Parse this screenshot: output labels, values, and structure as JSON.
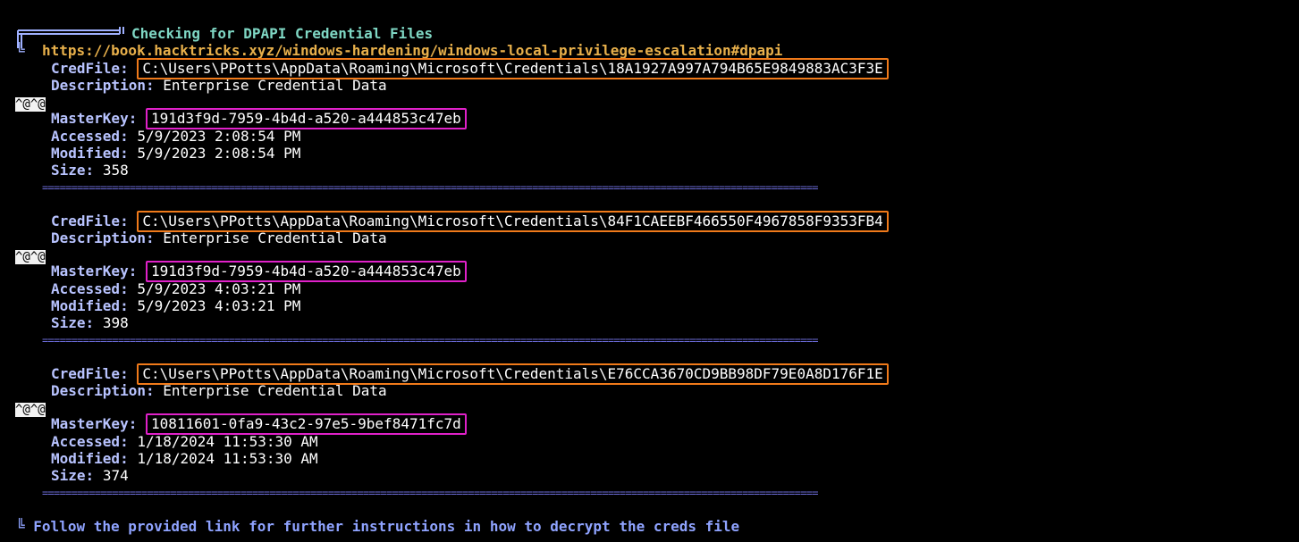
{
  "header": {
    "title": "Checking for DPAPI Credential Files",
    "link": "https://book.hacktricks.xyz/windows-hardening/windows-local-privilege-escalation#dpapi"
  },
  "labels": {
    "credfile": "CredFile:",
    "description": "Description:",
    "masterkey": "MasterKey:",
    "accessed": "Accessed:",
    "modified": "Modified:",
    "size": "Size:"
  },
  "control_marker": "^@^@",
  "separator": "=====================================================================================================================================",
  "entries": [
    {
      "credfile": "C:\\Users\\PPotts\\AppData\\Roaming\\Microsoft\\Credentials\\18A1927A997A794B65E9849883AC3F3E",
      "description": "Enterprise Credential Data",
      "masterkey": "191d3f9d-7959-4b4d-a520-a444853c47eb",
      "accessed": "5/9/2023 2:08:54 PM",
      "modified": "5/9/2023 2:08:54 PM",
      "size": "358"
    },
    {
      "credfile": "C:\\Users\\PPotts\\AppData\\Roaming\\Microsoft\\Credentials\\84F1CAEEBF466550F4967858F9353FB4",
      "description": "Enterprise Credential Data",
      "masterkey": "191d3f9d-7959-4b4d-a520-a444853c47eb",
      "accessed": "5/9/2023 4:03:21 PM",
      "modified": "5/9/2023 4:03:21 PM",
      "size": "398"
    },
    {
      "credfile": "C:\\Users\\PPotts\\AppData\\Roaming\\Microsoft\\Credentials\\E76CCA3670CD9BB98DF79E0A8D176F1E",
      "description": "Enterprise Credential Data",
      "masterkey": "10811601-0fa9-43c2-97e5-9bef8471fc7d",
      "accessed": "1/18/2024 11:53:30 AM",
      "modified": "1/18/2024 11:53:30 AM",
      "size": "374"
    }
  ],
  "footer": {
    "marker": "╚",
    "text": "Follow the provided link for further instructions in how to decrypt the creds file"
  },
  "colors": {
    "background": "#000000",
    "title": "#7fd7c4",
    "link": "#e8b04b",
    "label": "#b8c3ff",
    "highlight_credfile": "#f07a1a",
    "highlight_masterkey": "#e021c9",
    "separator": "#6b6bd8",
    "footer": "#8fa3ff"
  }
}
